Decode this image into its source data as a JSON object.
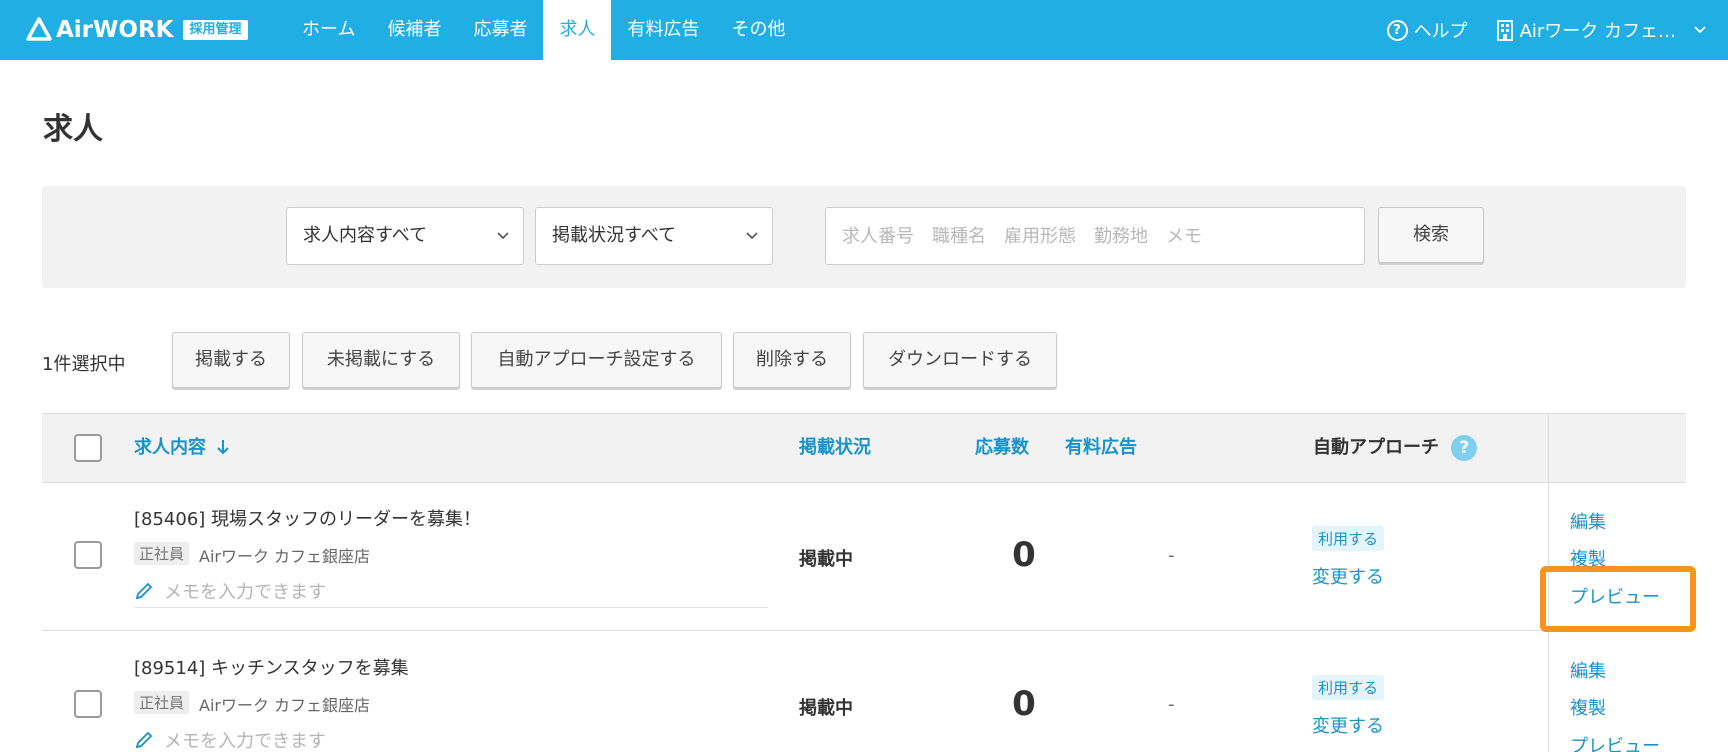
{
  "header": {
    "logo_text": "AirWORK",
    "logo_badge": "採用管理",
    "nav": [
      "ホーム",
      "候補者",
      "応募者",
      "求人",
      "有料広告",
      "その他"
    ],
    "active_nav_index": 3,
    "help_label": "ヘルプ",
    "account_name": "Airワーク カフェ…"
  },
  "page": {
    "title": "求人"
  },
  "search": {
    "content_select": "求人内容すべて",
    "status_select": "掲載状況すべて",
    "placeholder": "求人番号　職種名　雇用形態　勤務地　メモ",
    "button": "検索"
  },
  "actions": {
    "selected_count": "1件選択中",
    "publish": "掲載する",
    "unpublish": "未掲載にする",
    "auto_approach": "自動アプローチ設定する",
    "delete": "削除する",
    "download": "ダウンロードする"
  },
  "table": {
    "columns": {
      "content": "求人内容",
      "status": "掲載状況",
      "applicants": "応募数",
      "paid_ads": "有料広告",
      "auto_approach": "自動アプローチ"
    },
    "rows": [
      {
        "title": "[85406] 現場スタッフのリーダーを募集！",
        "employment": "正社員",
        "store": "Airワーク カフェ銀座店",
        "memo_placeholder": "メモを入力できます",
        "status": "掲載中",
        "applicants": "0",
        "paid_ads": "-",
        "auto_badge": "利用する",
        "auto_change": "変更する",
        "edit": "編集",
        "duplicate": "複製",
        "preview": "プレビュー"
      },
      {
        "title": "[89514] キッチンスタッフを募集",
        "employment": "正社員",
        "store": "Airワーク カフェ銀座店",
        "memo_placeholder": "メモを入力できます",
        "status": "掲載中",
        "applicants": "0",
        "paid_ads": "-",
        "auto_badge": "利用する",
        "auto_change": "変更する",
        "edit": "編集",
        "duplicate": "複製",
        "preview": "プレビュー"
      }
    ]
  },
  "colors": {
    "header_bg": "#21aee5",
    "link": "#1a93c9",
    "highlight": "#f7931e"
  }
}
